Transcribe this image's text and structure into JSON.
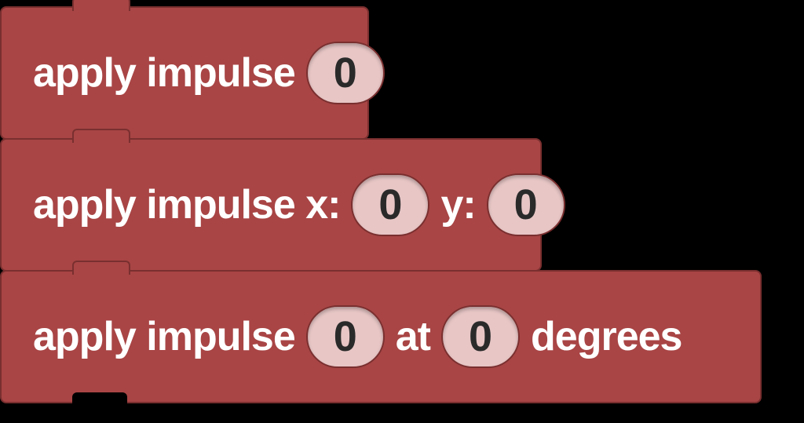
{
  "blocks": [
    {
      "label_before": "apply impulse",
      "inputs": [
        {
          "value": "0"
        }
      ]
    },
    {
      "parts": [
        {
          "type": "text",
          "value": "apply impulse x:"
        },
        {
          "type": "input",
          "value": "0"
        },
        {
          "type": "text",
          "value": "y:"
        },
        {
          "type": "input",
          "value": "0"
        }
      ]
    },
    {
      "parts": [
        {
          "type": "text",
          "value": "apply impulse"
        },
        {
          "type": "input",
          "value": "0"
        },
        {
          "type": "text",
          "value": "at"
        },
        {
          "type": "input",
          "value": "0"
        },
        {
          "type": "text",
          "value": "degrees"
        }
      ]
    }
  ]
}
